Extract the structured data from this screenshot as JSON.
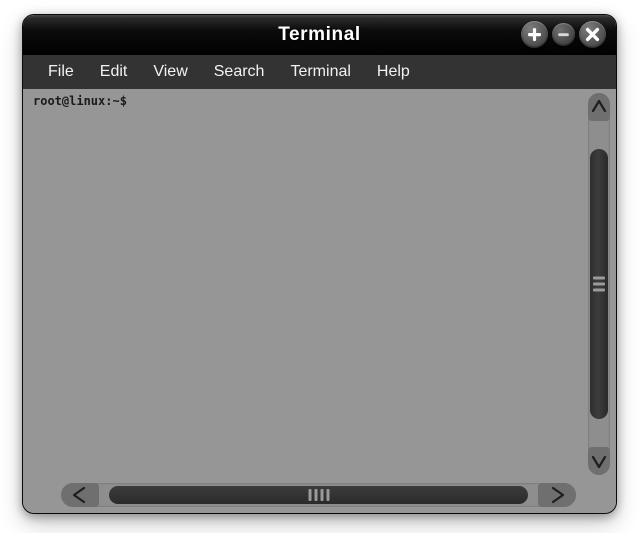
{
  "window": {
    "title": "Terminal",
    "controls": [
      {
        "name": "maximize-button",
        "icon": "plus-icon",
        "label": "+"
      },
      {
        "name": "minimize-button",
        "icon": "minus-icon",
        "label": "–"
      },
      {
        "name": "close-button",
        "icon": "close-icon",
        "label": "✕"
      }
    ]
  },
  "menubar": {
    "items": [
      {
        "label": "File"
      },
      {
        "label": "Edit"
      },
      {
        "label": "View"
      },
      {
        "label": "Search"
      },
      {
        "label": "Terminal"
      },
      {
        "label": "Help"
      }
    ]
  },
  "terminal": {
    "lines": [
      "root@linux:~$"
    ],
    "prompt_user": "root",
    "prompt_host": "linux",
    "prompt_path": "~",
    "prompt_symbol": "$",
    "background_color": "#969696",
    "foreground_color": "#1b1b1b"
  },
  "scrollbars": {
    "vertical": {
      "up_arrow_icon": "chevron-up-icon",
      "down_arrow_icon": "chevron-down-icon",
      "thumb_label": ""
    },
    "horizontal": {
      "left_arrow_icon": "chevron-left-icon",
      "right_arrow_icon": "chevron-right-icon",
      "thumb_label": ""
    }
  },
  "colors": {
    "titlebar": "#000000",
    "menubar": "#333333",
    "terminal_bg": "#969696",
    "scroll_trough": "#8e8e8e",
    "scroll_thumb": "#333333",
    "desktop_bg": "#ffffff"
  }
}
